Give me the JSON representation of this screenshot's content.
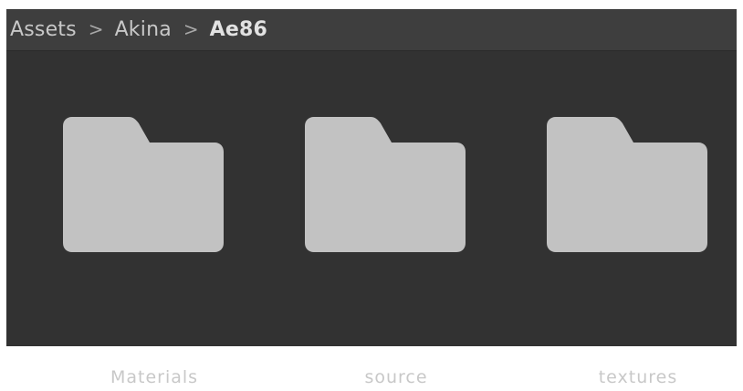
{
  "breadcrumb": {
    "items": [
      {
        "label": "Assets"
      },
      {
        "label": "Akina"
      },
      {
        "label": "Ae86"
      }
    ],
    "separator": ">"
  },
  "folders": [
    {
      "label": "Materials",
      "icon": "folder-icon"
    },
    {
      "label": "source",
      "icon": "folder-icon"
    },
    {
      "label": "textures",
      "icon": "folder-icon"
    }
  ],
  "colors": {
    "window_bg": "#323232",
    "header_bg": "#3e3e3e",
    "folder_fill": "#c2c2c2",
    "text": "#c8c8c8"
  }
}
